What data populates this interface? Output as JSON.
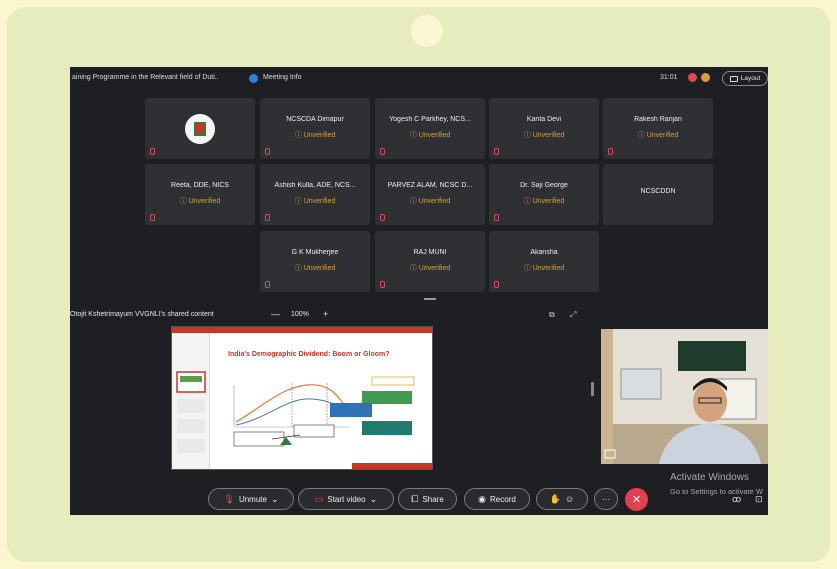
{
  "meeting": {
    "title": "aining Programme in the Relevant field of Duti..",
    "info_label": "Meeting Info",
    "timer": "31:01",
    "layout_label": "Layout",
    "colors": {
      "accent": "#2f7fe0",
      "unverified": "#d9a13a",
      "end_call": "#e23f4f"
    }
  },
  "participants": [
    {
      "name": "",
      "status": "",
      "icon": "org-logo-icon"
    },
    {
      "name": "NCSCDA Dimapur",
      "status": "ⓘ Unverified"
    },
    {
      "name": "Yogesh C Parkhey, NCS...",
      "status": "ⓘ Unverified"
    },
    {
      "name": "Kanta Devi",
      "status": "ⓘ Unverified"
    },
    {
      "name": "Rakesh Ranjan",
      "status": "ⓘ Unverified"
    },
    {
      "name": "Reeta, DDE, NICS",
      "status": "ⓘ Unverified"
    },
    {
      "name": "Ashish Kulla, ADE, NCS...",
      "status": "ⓘ Unverified"
    },
    {
      "name": "PARVEZ ALAM, NCSC D...",
      "status": "ⓘ Unverified"
    },
    {
      "name": "Dr. Saji George",
      "status": "ⓘ Unverified"
    },
    {
      "name": "NCSCDDN",
      "status": ""
    },
    {
      "name": "G K Mukherjee",
      "status": "ⓘ Unverified"
    },
    {
      "name": "RAJ MUNI",
      "status": "ⓘ Unverified"
    },
    {
      "name": "Akansha",
      "status": "ⓘ Unverified"
    }
  ],
  "share": {
    "label": "Otojit Kshetrimayum VVGNLI's shared content",
    "zoom": "100%",
    "minus": "—",
    "plus": "+",
    "slide_title": "India's Demographic Dividend: Boom or Gloom?"
  },
  "watermark": {
    "line1": "Activate Windows",
    "line2": "Go to Settings to activate W"
  },
  "controls": {
    "unmute": "Unmute",
    "start_video": "Start video",
    "share": "Share",
    "record": "Record",
    "more": "···"
  }
}
